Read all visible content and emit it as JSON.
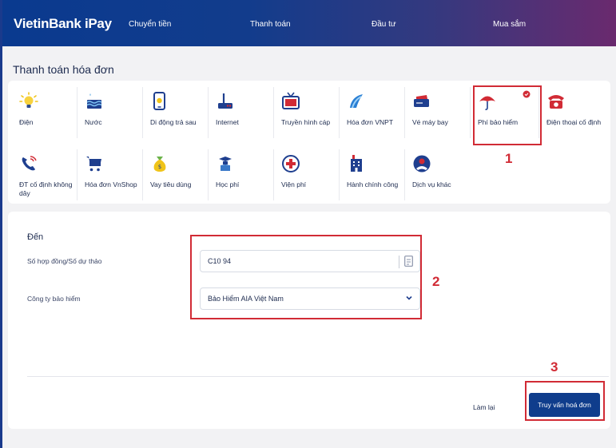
{
  "header": {
    "logo": "VietinBank iPay",
    "nav": [
      "Chuyển tiền",
      "Thanh toán",
      "Đầu tư",
      "Mua sắm"
    ]
  },
  "page": {
    "title": "Thanh toán hóa đơn"
  },
  "services": {
    "row1": [
      {
        "label": "Điện",
        "icon": "lightbulb-icon"
      },
      {
        "label": "Nước",
        "icon": "water-icon"
      },
      {
        "label": "Di động trả sau",
        "icon": "mobile-phone-icon"
      },
      {
        "label": "Internet",
        "icon": "router-icon"
      },
      {
        "label": "Truyền hình cáp",
        "icon": "tv-icon"
      },
      {
        "label": "Hóa đơn VNPT",
        "icon": "vnpt-logo-icon"
      },
      {
        "label": "Vé máy bay",
        "icon": "plane-ticket-icon"
      },
      {
        "label": "Phí bảo hiểm",
        "icon": "umbrella-icon"
      },
      {
        "label": "Điện thoại cố định",
        "icon": "landline-phone-icon"
      }
    ],
    "row2": [
      {
        "label": "ĐT cố định không dây",
        "icon": "wireless-phone-icon"
      },
      {
        "label": "Hóa đơn VnShop",
        "icon": "cart-icon"
      },
      {
        "label": "Vay tiêu dùng",
        "icon": "money-bag-icon"
      },
      {
        "label": "Học phí",
        "icon": "graduation-icon"
      },
      {
        "label": "Viện phí",
        "icon": "hospital-cross-icon"
      },
      {
        "label": "Hành chính công",
        "icon": "building-icon"
      },
      {
        "label": "Dịch vụ khác",
        "icon": "person-circle-icon"
      }
    ]
  },
  "form": {
    "title": "Đến",
    "contract_label": "Số hợp đồng/Số dự thảo",
    "contract_value": "C10       94",
    "company_label": "Công ty bảo hiểm",
    "company_value": "Bảo Hiểm AIA Việt Nam",
    "reset_label": "Làm lại",
    "submit_label": "Truy vấn hoá đơn"
  },
  "annotations": {
    "step1": "1",
    "step2": "2",
    "step3": "3"
  },
  "colors": {
    "primary": "#0f3d8c",
    "highlight": "#d12b35"
  }
}
